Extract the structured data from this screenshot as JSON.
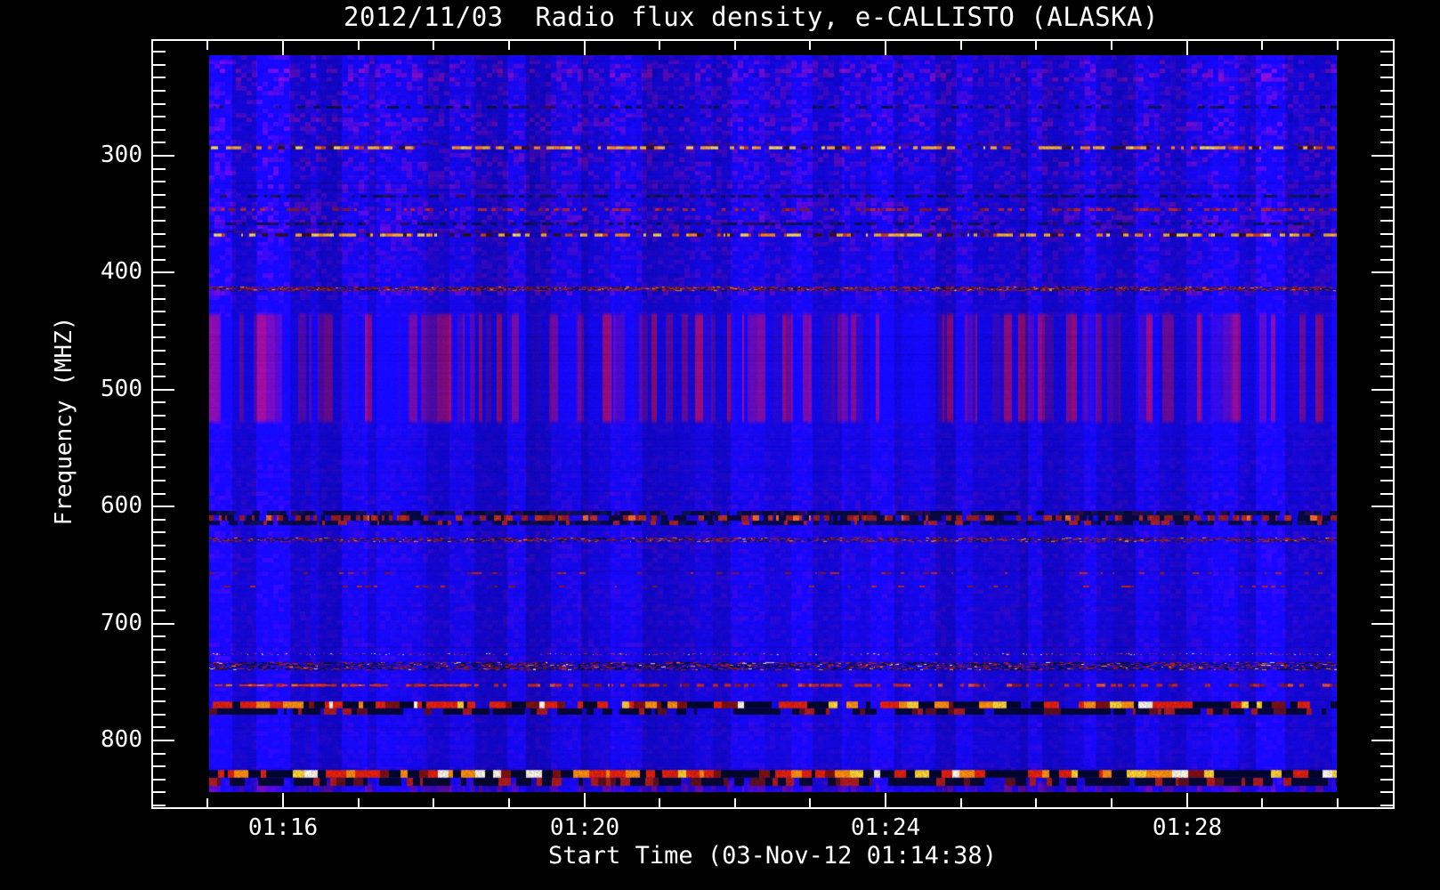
{
  "page": {
    "background": "#000000",
    "text_color": "#ffffff"
  },
  "chart_data": {
    "type": "heatmap",
    "subtype": "radio-spectrogram",
    "title": "2012/11/03  Radio flux density, e-CALLISTO (ALASKA)",
    "xlabel": "Start Time (03-Nov-12 01:14:38)",
    "ylabel": "Frequency (MHZ)",
    "x_major_ticks": [
      "01:16",
      "01:20",
      "01:24",
      "01:28"
    ],
    "x_minor_ticks": [
      "01:15",
      "01:17",
      "01:18",
      "01:19",
      "01:21",
      "01:22",
      "01:23",
      "01:25",
      "01:26",
      "01:27",
      "01:29",
      "01:30"
    ],
    "y_major_ticks": [
      300,
      400,
      500,
      600,
      700,
      800
    ],
    "x_range": [
      "01:15:00",
      "01:30:00"
    ],
    "start_time_label": "01:14:38",
    "y_range_mhz": [
      214,
      844
    ],
    "y_axis_increases_downward": true,
    "grid": false,
    "legend": "none",
    "colors": {
      "background": "#000000",
      "axis": "#ffffff",
      "base_blue": "#1407e6",
      "stripe_magenta": "#8c0aa6",
      "patch_red": "#7a1464"
    },
    "palettes": {
      "bright": [
        "#ffb224",
        "#ffd84a",
        "#ff8412",
        "#d2400c"
      ],
      "halo": [
        "#701410",
        "#26081c"
      ],
      "red": [
        "#d02810",
        "#8e1a0c"
      ],
      "dark": [
        "#04103a",
        "#0a1252",
        "#2e0c44"
      ],
      "speckle": [
        "#040c34",
        "#b42410",
        "#7a1608",
        "#ff9820",
        "#e8e8ff"
      ],
      "dot": [
        "#c03010",
        "#e8e8ff",
        "#101060"
      ],
      "band_dark_top": [
        "#020830",
        "#0a1048",
        "#2a0a3c"
      ],
      "band_red_mid": [
        "#9c1c0c",
        "#c23008",
        "#ff7014",
        "#040830"
      ],
      "strong_bright": [
        "#010620",
        "#e02000",
        "#ff8c00",
        "#ffd028",
        "#fff6d8",
        "#7c1004"
      ],
      "strong_dark": [
        "#010620",
        "#b01c08",
        "#60100a"
      ]
    },
    "stripe_bands_mhz": [
      {
        "range": [
          437,
          525
        ],
        "strength": 1.0
      },
      {
        "range": [
          838,
          844
        ],
        "strength": 0.6
      }
    ],
    "rfi_bands": [
      {
        "freq_mhz": 258,
        "type": "dark_dash",
        "thickness": 3,
        "density": 0.45
      },
      {
        "freq_mhz": 292,
        "type": "bright_dash",
        "thickness": 5,
        "density": 0.52
      },
      {
        "freq_mhz": 334,
        "type": "dark_dash",
        "thickness": 3,
        "density": 0.7
      },
      {
        "freq_mhz": 346,
        "type": "red_dash",
        "thickness": 3,
        "density": 0.4
      },
      {
        "freq_mhz": 358,
        "type": "dark_dash",
        "thickness": 3,
        "density": 0.6
      },
      {
        "freq_mhz": 367,
        "type": "bright_dash",
        "thickness": 5,
        "density": 0.42
      },
      {
        "freq_mhz": 413,
        "type": "speckle_line",
        "thickness": 5,
        "density": 0.95
      },
      {
        "freq_mhz": 610,
        "type": "dark_band",
        "thickness": 16,
        "density": 1.0
      },
      {
        "freq_mhz": 628,
        "type": "speckle_line",
        "thickness": 5,
        "density": 0.7
      },
      {
        "freq_mhz": 657,
        "type": "red_dash",
        "thickness": 2,
        "density": 0.18
      },
      {
        "freq_mhz": 668,
        "type": "red_dash",
        "thickness": 2,
        "density": 0.12
      },
      {
        "freq_mhz": 726,
        "type": "dot_line",
        "thickness": 2,
        "density": 0.55
      },
      {
        "freq_mhz": 736,
        "type": "speckle_band",
        "thickness": 9,
        "density": 0.85
      },
      {
        "freq_mhz": 753,
        "type": "red_line",
        "thickness": 4,
        "density": 0.6
      },
      {
        "freq_mhz": 772,
        "type": "strong_band",
        "thickness": 15,
        "density": 1.0
      },
      {
        "freq_mhz": 832,
        "type": "strong_band",
        "thickness": 18,
        "density": 1.3
      }
    ]
  }
}
